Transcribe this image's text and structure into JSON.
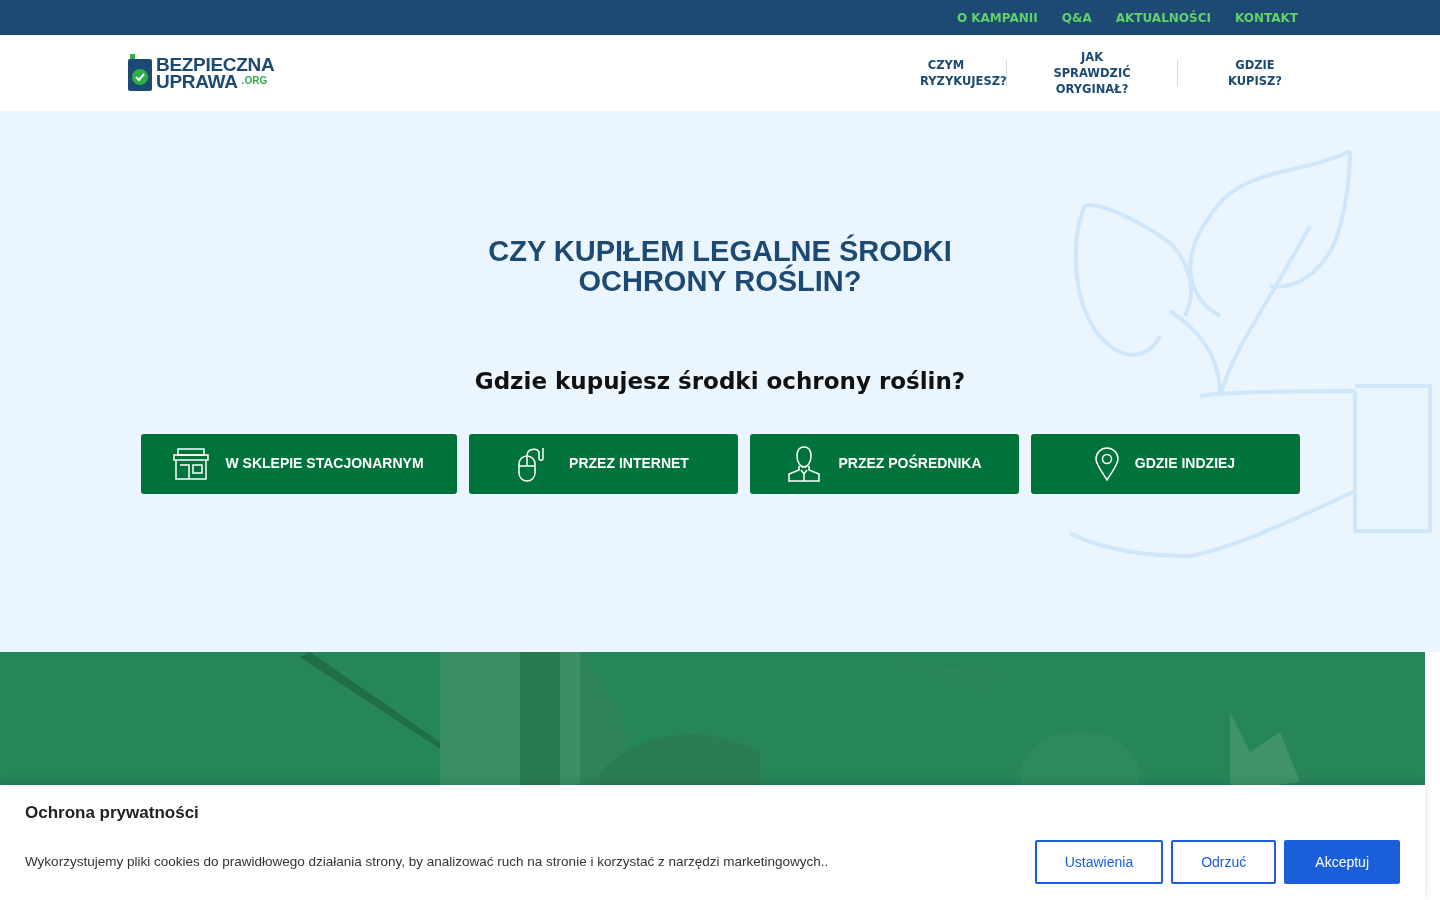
{
  "top_menu": [
    {
      "label": "O KAMPANII"
    },
    {
      "label": "Q&A"
    },
    {
      "label": "AKTUALNOŚCI"
    },
    {
      "label": "KONTAKT"
    }
  ],
  "logo": {
    "line_1": "BEZPIECZNA",
    "line_2": "UPRAWA",
    "suffix": ".ORG"
  },
  "main_menu": [
    {
      "label": "CZYM RYZYKUJESZ?"
    },
    {
      "label": "JAK SPRAWDZIĆ ORYGINAŁ?"
    },
    {
      "label": "GDZIE KUPISZ?"
    }
  ],
  "hero": {
    "title": "CZY KUPIŁEM LEGALNE ŚRODKI OCHRONY ROŚLIN?",
    "question": "Gdzie kupujesz środki ochrony roślin?",
    "options": [
      {
        "kind": "store",
        "label": "W SKLEPIE STACJONARNYM"
      },
      {
        "kind": "internet",
        "label": "PRZEZ INTERNET"
      },
      {
        "kind": "agent",
        "label": "PRZEZ POŚREDNIKA"
      },
      {
        "kind": "location",
        "label": "GDZIE INDZIEJ"
      }
    ]
  },
  "cookie_notice": {
    "title": "Ochrona prywatności",
    "text": "Wykorzystujemy pliki cookies do prawidłowego działania strony, by analizować ruch na stronie i korzystać z narzędzi marketingowych..",
    "buttons": [
      {
        "label": "Ustawienia",
        "kind": "outline"
      },
      {
        "label": "Odrzuć",
        "kind": "outline"
      },
      {
        "label": "Akceptuj",
        "kind": "primary"
      }
    ]
  }
}
